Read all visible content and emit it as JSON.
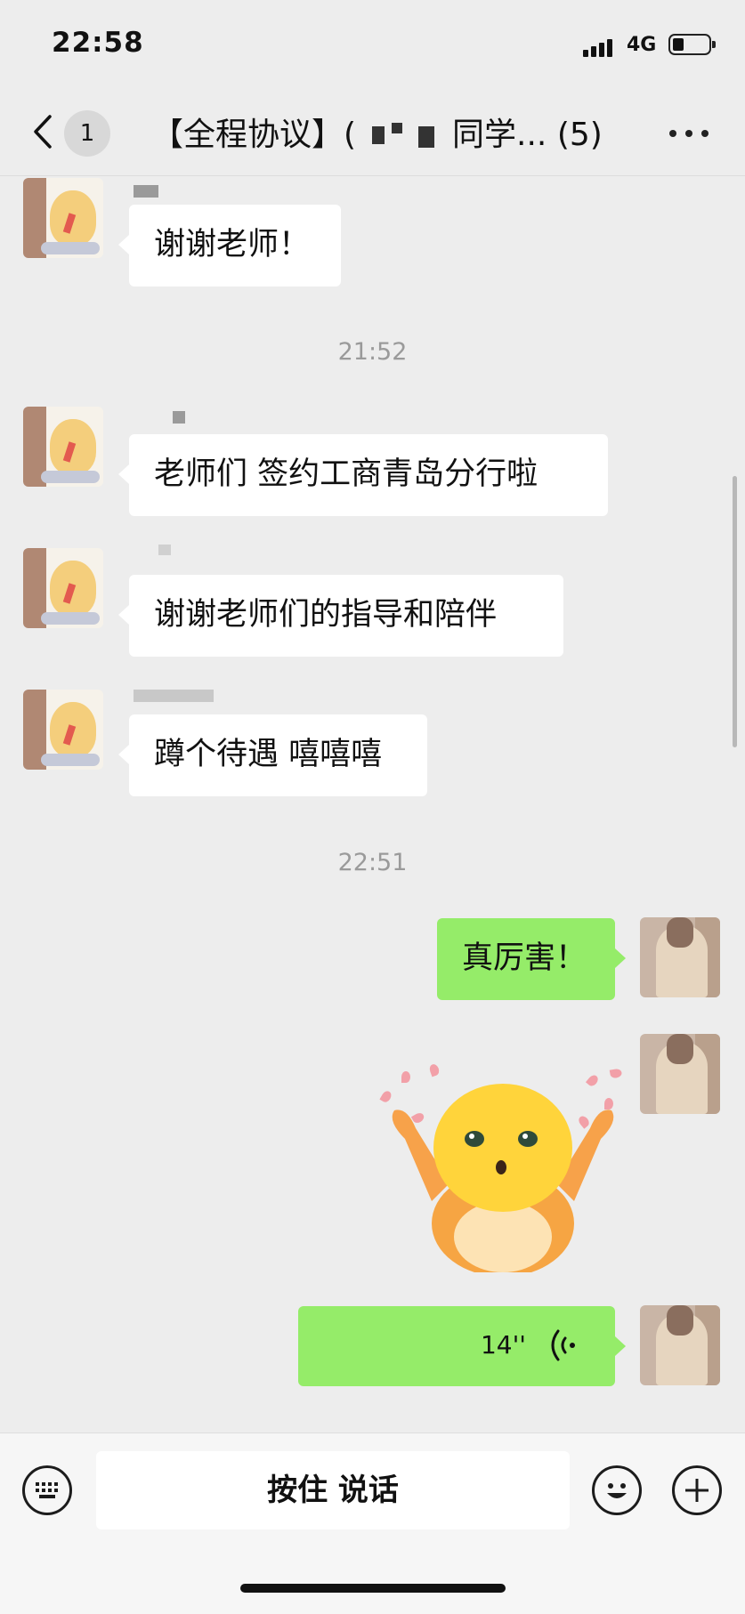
{
  "status_bar": {
    "time": "22:58",
    "network": "4G"
  },
  "nav": {
    "back_label": "back",
    "unread_count": "1",
    "title_prefix": "【全程协议】(",
    "title_suffix": "同学... (5)"
  },
  "messages": [
    {
      "side": "in",
      "text": "谢谢老师！"
    },
    {
      "side": "in",
      "text": "老师们 签约工商青岛分行啦"
    },
    {
      "side": "in",
      "text": "谢谢老师们的指导和陪伴"
    },
    {
      "side": "in",
      "text": "蹲个待遇 嘻嘻嘻"
    },
    {
      "side": "out",
      "text": "真厉害！"
    },
    {
      "side": "out",
      "type": "sticker"
    },
    {
      "side": "out",
      "type": "voice",
      "duration": "14''"
    }
  ],
  "timestamps": [
    "21:52",
    "22:51"
  ],
  "input_bar": {
    "voice_button": "按住 说话"
  },
  "icons": [
    "back-chevron-icon",
    "more-icon",
    "keyboard-icon",
    "emoji-icon",
    "plus-icon",
    "voice-wave-icon"
  ]
}
